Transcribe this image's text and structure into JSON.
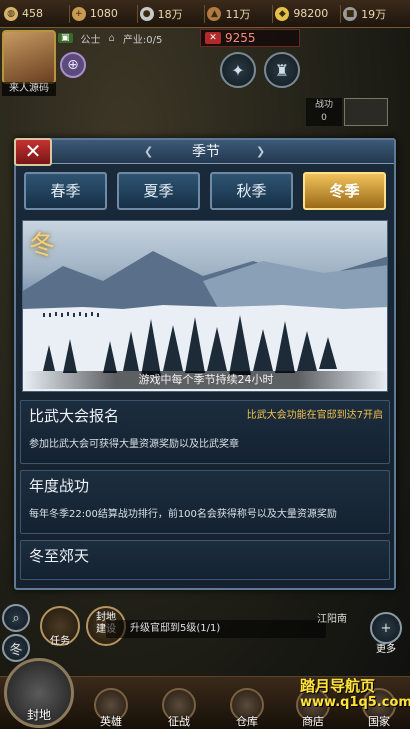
{
  "resources": [
    {
      "icon": "rice-icon",
      "value": "458",
      "color": "#d8b46a"
    },
    {
      "icon": "sword-icon",
      "value": "1080",
      "color": "#c89a52"
    },
    {
      "icon": "coin-icon",
      "value": "18万",
      "color": "#c8c8c8"
    },
    {
      "icon": "wood-icon",
      "value": "11万",
      "color": "#b07a42"
    },
    {
      "icon": "gold-icon",
      "value": "98200",
      "color": "#e4c04a"
    },
    {
      "icon": "stone-icon",
      "value": "19万",
      "color": "#9a9a9a"
    }
  ],
  "player": {
    "name": "来人源码",
    "rank": "公士",
    "industry": "产业:0/5",
    "power": "9255"
  },
  "battle": {
    "label": "战功",
    "value": "0"
  },
  "dialog": {
    "title": "季节",
    "tabs": [
      "春季",
      "夏季",
      "秋季",
      "冬季"
    ],
    "active_tab": "冬季",
    "scene_badge": "冬",
    "scene_caption": "游戏中每个季节持续24小时",
    "cards": [
      {
        "title": "比武大会报名",
        "note": "比武大会功能在官邸到达7开启",
        "desc": "参加比武大会可获得大量资源奖励以及比武奖章"
      },
      {
        "title": "年度战功",
        "desc": "每年冬季22:00结算战功排行，前100名会获得称号以及大量资源奖励"
      },
      {
        "title": "冬至郊天"
      }
    ]
  },
  "hud": {
    "season_badge": "冬",
    "task_label": "任务",
    "fief_label": "封地\n建设",
    "quest_text": "升级官邸到5级(1/1)",
    "location": "江阳南",
    "more_label": "更多"
  },
  "nav": [
    {
      "label": "封地",
      "icon": "castle-icon"
    },
    {
      "label": "英雄",
      "icon": "hero-icon"
    },
    {
      "label": "征战",
      "icon": "crossed-swords-icon"
    },
    {
      "label": "仓库",
      "icon": "warehouse-icon"
    },
    {
      "label": "商店",
      "icon": "shop-icon"
    },
    {
      "label": "国家",
      "icon": "flag-icon"
    }
  ],
  "watermark": {
    "line1": "踏月导航页",
    "line2": "www.q1q5.com"
  }
}
